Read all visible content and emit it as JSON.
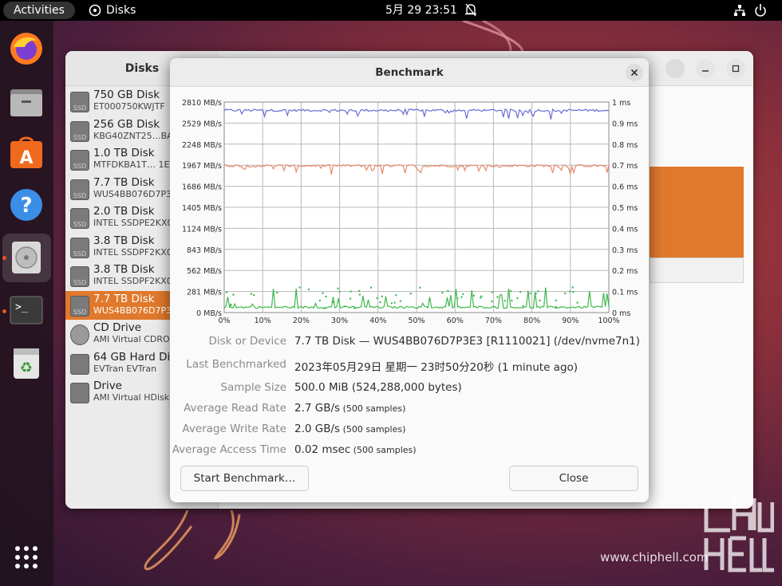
{
  "topbar": {
    "activities": "Activities",
    "app_name": "Disks",
    "clock": "5月 29  23:51"
  },
  "dock": {
    "items": [
      "firefox-icon",
      "files-icon",
      "software-icon",
      "help-icon",
      "disks-icon",
      "terminal-icon",
      "trash-icon",
      "apps-grid-icon"
    ]
  },
  "disks": {
    "title": "Disks",
    "drives": [
      {
        "name": "750 GB Disk",
        "model": "ET000750KWJTF",
        "icon": "SSD"
      },
      {
        "name": "256 GB Disk",
        "model": "KBG40ZNT25…BA",
        "icon": "SSD"
      },
      {
        "name": "1.0 TB Disk",
        "model": "MTFDKBA1T…  1E",
        "icon": "SSD"
      },
      {
        "name": "7.7 TB Disk",
        "model": "WUS4BB076D7P3",
        "icon": "SSD"
      },
      {
        "name": "2.0 TB Disk",
        "model": "INTEL SSDPE2KX0",
        "icon": "SSD"
      },
      {
        "name": "3.8 TB Disk",
        "model": "INTEL SSDPF2KX0",
        "icon": "SSD"
      },
      {
        "name": "3.8 TB Disk",
        "model": "INTEL SSDPF2KX0",
        "icon": "SSD"
      },
      {
        "name": "7.7 TB Disk",
        "model": "WUS4BB076D7P3",
        "icon": "SSD"
      },
      {
        "name": "CD Drive",
        "model": "AMI Virtual CDRO",
        "icon": "cd"
      },
      {
        "name": "64 GB Hard Disk",
        "model": "EVTran EVTran",
        "icon": "usb"
      },
      {
        "name": "Drive",
        "model": "AMI Virtual HDisk0",
        "icon": "usb"
      }
    ],
    "selected_index": 7
  },
  "dialog": {
    "title": "Benchmark",
    "close_label": "Close",
    "start_label": "Start Benchmark…",
    "info": [
      {
        "key": "Disk or Device",
        "value": "7.7 TB Disk — WUS4BB076D7P3E3 [R1110021] (/dev/nvme7n1)",
        "sub": ""
      },
      {
        "key": "Last Benchmarked",
        "value": "2023年05月29日 星期一 23时50分20秒 (1 minute ago)",
        "sub": ""
      },
      {
        "key": "Sample Size",
        "value": "500.0 MiB (524,288,000 bytes)",
        "sub": ""
      },
      {
        "key": "Average Read Rate",
        "value": "2.7 GB/s",
        "sub": "(500 samples)"
      },
      {
        "key": "Average Write Rate",
        "value": "2.0 GB/s",
        "sub": "(500 samples)"
      },
      {
        "key": "Average Access Time",
        "value": "0.02 msec",
        "sub": "(500 samples)"
      }
    ]
  },
  "chart_data": {
    "type": "line",
    "left_ticks": [
      "2810 MB/s",
      "2529 MB/s",
      "2248 MB/s",
      "1967 MB/s",
      "1686 MB/s",
      "1405 MB/s",
      "1124 MB/s",
      "843 MB/s",
      "562 MB/s",
      "281 MB/s",
      "0 MB/s"
    ],
    "right_ticks": [
      "1 ms",
      "0.9 ms",
      "0.8 ms",
      "0.7 ms",
      "0.6 ms",
      "0.5 ms",
      "0.4 ms",
      "0.3 ms",
      "0.2 ms",
      "0.1 ms",
      "0 ms"
    ],
    "x_ticks": [
      "0%",
      "10%",
      "20%",
      "30%",
      "40%",
      "50%",
      "60%",
      "70%",
      "80%",
      "90%",
      "100%"
    ],
    "ylim_rate_mbps": [
      0,
      2810
    ],
    "ylim_access_ms": [
      0,
      1
    ],
    "series": [
      {
        "key": "read",
        "color": "#6b6bd6",
        "approx_mean": 2700,
        "approx_min": 2580
      },
      {
        "key": "write",
        "color": "#e8896a",
        "approx_mean": 1960,
        "approx_min": 1850
      },
      {
        "key": "access",
        "color": "#3fb84c",
        "approx_mean": 0.02,
        "approx_max": 0.12
      }
    ],
    "grid": true
  },
  "watermark": {
    "url": "www.chiphell.com"
  }
}
